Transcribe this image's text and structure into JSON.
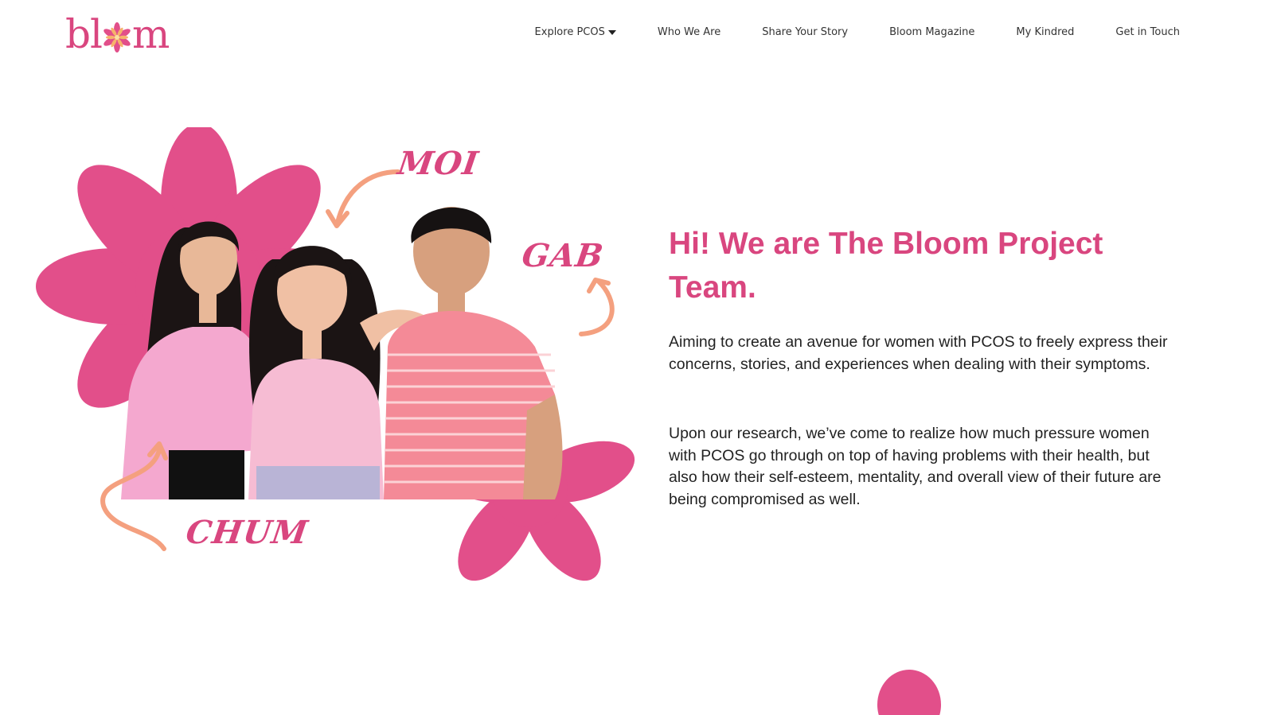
{
  "header": {
    "logo_text_left": "bl",
    "logo_text_right": "m",
    "logo_alt": "bloom",
    "nav": [
      {
        "label": "Explore PCOS",
        "has_dropdown": true
      },
      {
        "label": "Who We Are"
      },
      {
        "label": "Share Your Story"
      },
      {
        "label": "Bloom Magazine"
      },
      {
        "label": "My Kindred"
      },
      {
        "label": "Get in Touch"
      }
    ]
  },
  "hero": {
    "names": {
      "moi": "MOI",
      "gab": "GAB",
      "chum": "CHUM"
    },
    "title": "Hi! We are The Bloom Project Team.",
    "paragraph_1": "Aiming to create an avenue for women with PCOS to freely express their concerns, stories, and experiences when dealing with their symptoms.",
    "paragraph_2": "Upon our research, we’ve come to realize how much pressure women with PCOS go through on top of having problems with their health, but also how their self-esteem, mentality, and overall view of their future are being compromised as well."
  },
  "colors": {
    "brand_pink": "#d9467f",
    "flower_pink": "#e24f8a",
    "arrow_peach": "#f4a07f",
    "text_dark": "#222222"
  },
  "icons": {
    "logo_flower": "flower-icon",
    "dropdown": "caret-down-icon"
  }
}
